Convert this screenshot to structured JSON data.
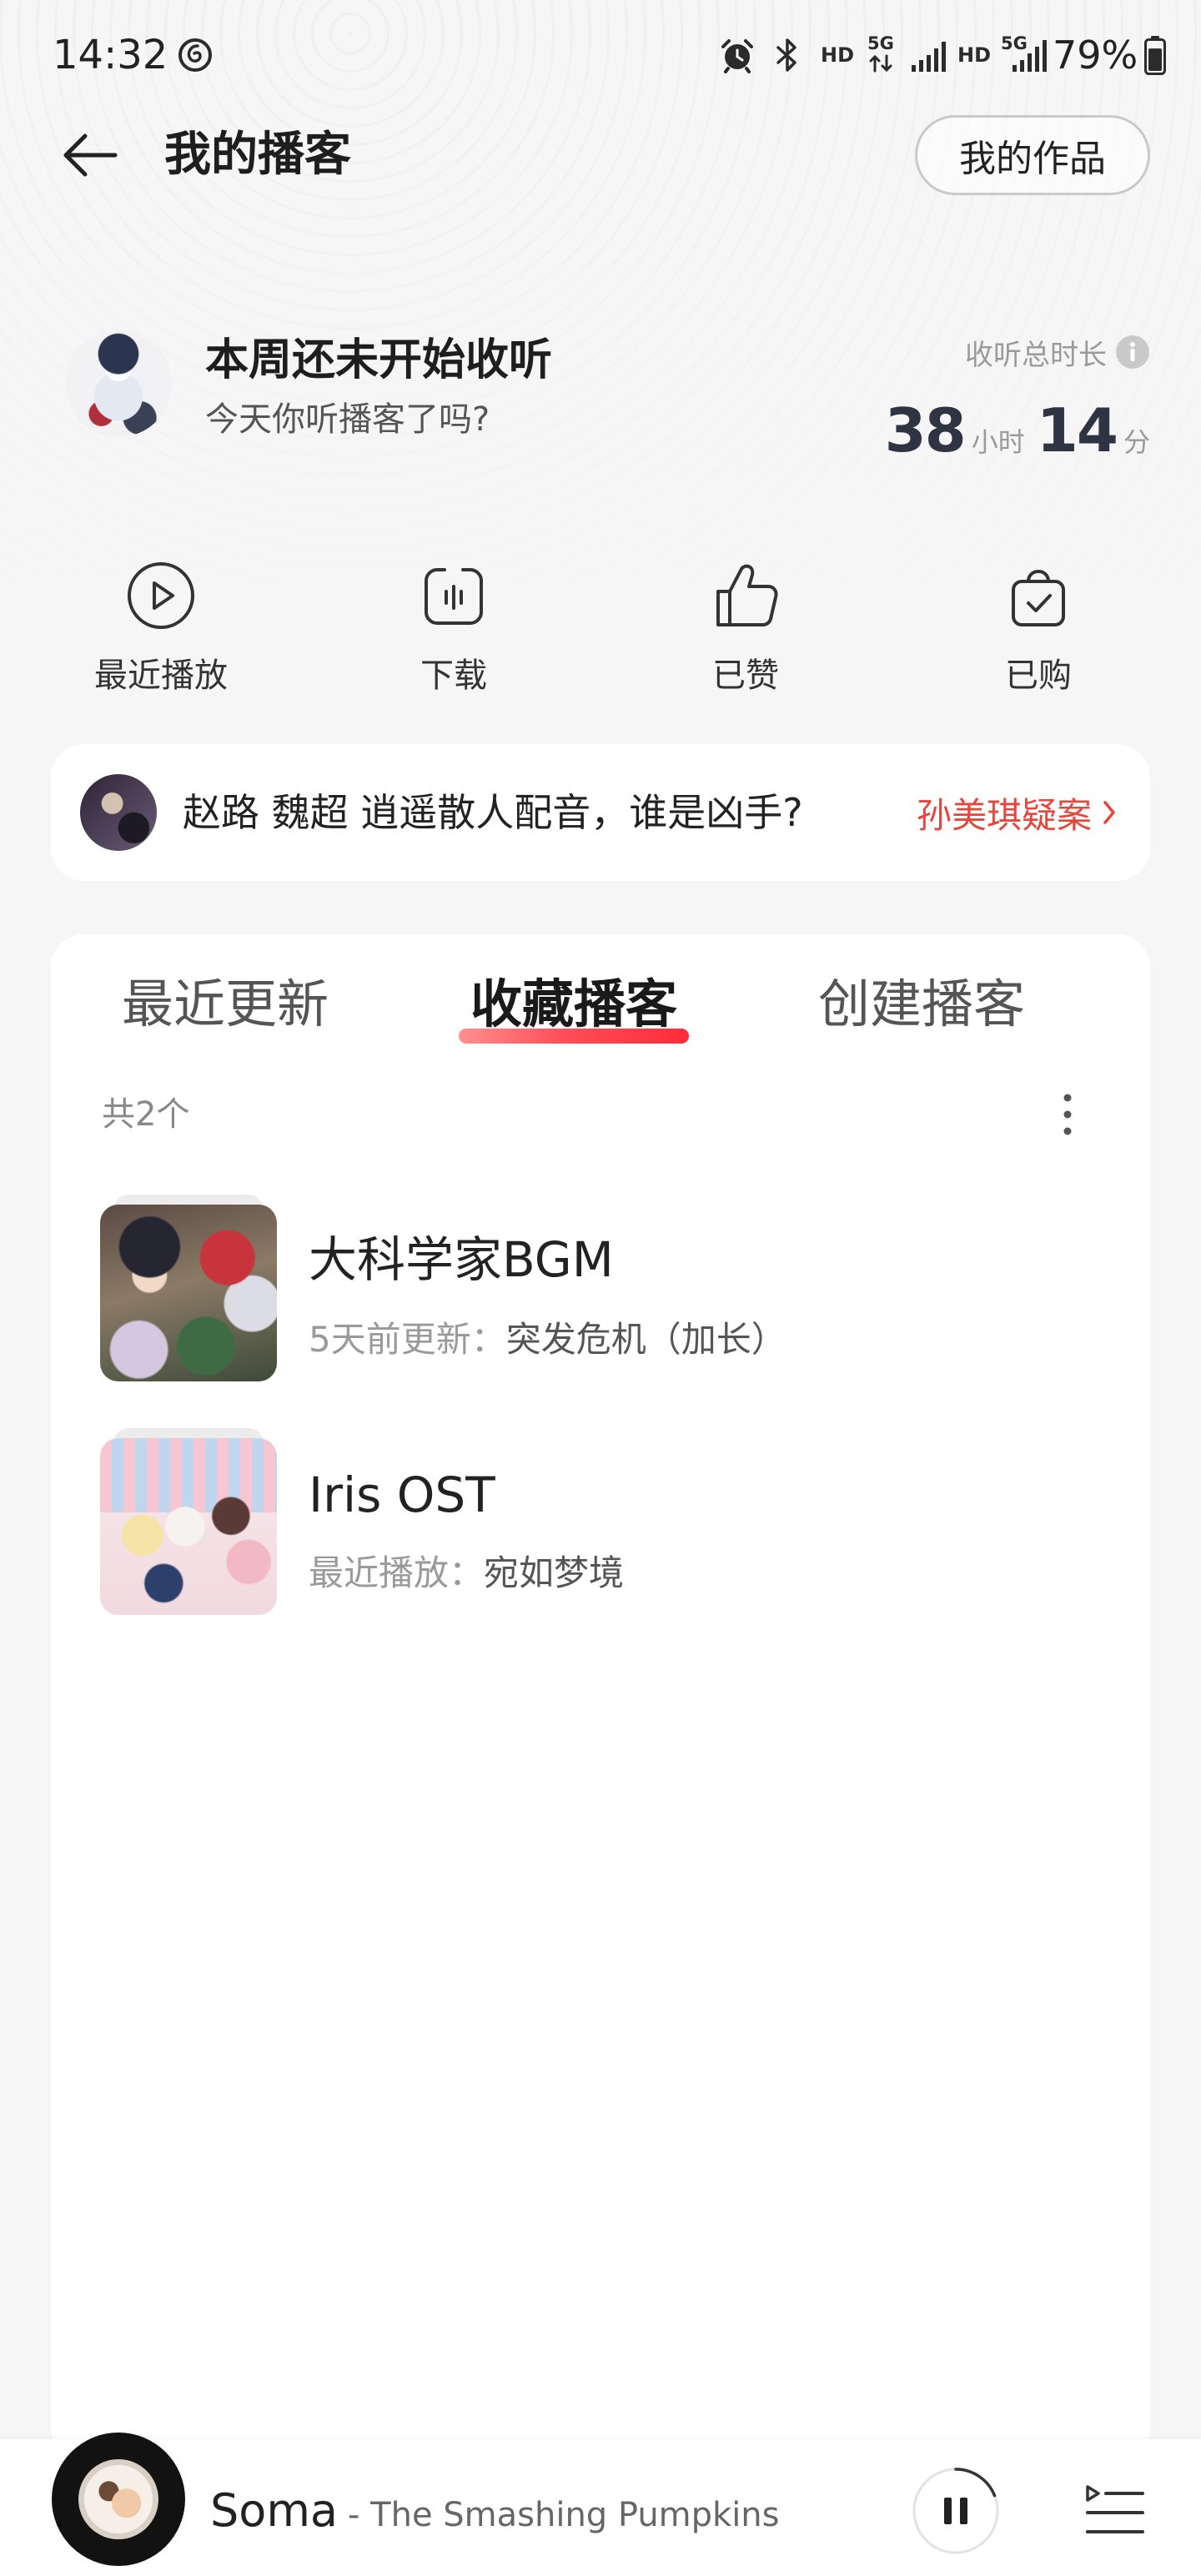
{
  "status_bar": {
    "time": "14:32",
    "sim1_hd": "HD",
    "sim1_network": "5G",
    "sim2_hd": "HD",
    "sim2_network": "5G",
    "battery_text": "79%",
    "battery_level": 0.79,
    "icons": [
      "music-app-icon",
      "alarm-icon",
      "bluetooth-icon",
      "signal-icon",
      "battery-icon"
    ]
  },
  "header": {
    "title": "我的播客",
    "my_works_button": "我的作品",
    "back_icon": "back-arrow-icon"
  },
  "profile": {
    "headline": "本周还未开始收听",
    "subline": "今天你听播客了吗?",
    "total_label": "收听总时长",
    "hours": "38",
    "hours_unit": "小时",
    "minutes": "14",
    "minutes_unit": "分"
  },
  "quick_actions": [
    {
      "label": "最近播放",
      "icon": "play-circle-icon"
    },
    {
      "label": "下载",
      "icon": "download-icon"
    },
    {
      "label": "已赞",
      "icon": "thumbs-up-icon"
    },
    {
      "label": "已购",
      "icon": "purchased-bag-icon"
    }
  ],
  "banner": {
    "text": "赵路 魏超 逍遥散人配音，谁是凶手?",
    "link_label": "孙美琪疑案"
  },
  "tabs": [
    {
      "label": "最近更新",
      "active": false
    },
    {
      "label": "收藏播客",
      "active": true
    },
    {
      "label": "创建播客",
      "active": false
    }
  ],
  "collection": {
    "count_label": "共2个",
    "items": [
      {
        "title": "大科学家BGM",
        "meta_label": "5天前更新：",
        "meta_value": "突发危机（加长）"
      },
      {
        "title": "Iris OST",
        "meta_label": "最近播放：",
        "meta_value": "宛如梦境"
      }
    ]
  },
  "player": {
    "title": "Soma",
    "artist": "- The Smashing Pumpkins",
    "control_icon": "pause-icon",
    "progress": 0.19
  },
  "colors": {
    "accent": "#e8453c",
    "tab_indicator": "#ff2b3a",
    "page_background": "#f6f6f6",
    "card_background": "#ffffff",
    "text_primary": "#222222",
    "text_secondary": "#9a9a9a"
  }
}
